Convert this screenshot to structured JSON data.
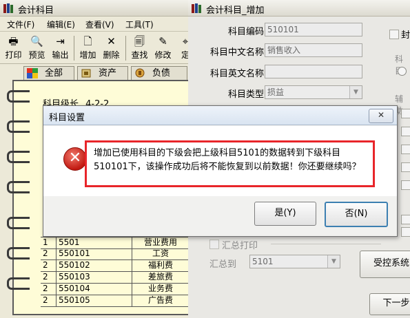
{
  "win1": {
    "title": "会计科目",
    "menu": [
      "文件(F)",
      "编辑(E)",
      "查看(V)",
      "工具(T)"
    ],
    "toolbar": [
      "打印",
      "预览",
      "输出",
      "增加",
      "删除",
      "查找",
      "修改",
      "定"
    ],
    "tabs": [
      "全部",
      "资产",
      "负债"
    ],
    "level_label": "科目级长",
    "level_value": "4-2-2",
    "rows": [
      {
        "grade": "1",
        "code": "5501",
        "name": "营业费用"
      },
      {
        "grade": "2",
        "code": "550101",
        "name": "工资"
      },
      {
        "grade": "2",
        "code": "550102",
        "name": "福利费"
      },
      {
        "grade": "2",
        "code": "550103",
        "name": "差旅费"
      },
      {
        "grade": "2",
        "code": "550104",
        "name": "业务费"
      },
      {
        "grade": "2",
        "code": "550105",
        "name": "广告费"
      }
    ]
  },
  "win2": {
    "title": "会计科目_增加",
    "code_label": "科目编码",
    "code_value": "510101",
    "cn_label": "科目中文名称",
    "cn_value": "销售收入",
    "en_label": "科目英文名称",
    "en_value": "",
    "type_label": "科目类型",
    "type_value": "损益",
    "seal_label": "封",
    "nature_label": "科目",
    "aux_label": "辅助",
    "summary_print_label": "汇总打印",
    "summary_to_label": "汇总到",
    "summary_to_value": "5101",
    "controlled_button": "受控系统",
    "next_button": "下一步"
  },
  "dialog": {
    "title": "科目设置",
    "close": "✕",
    "message": "增加已使用科目的下级会把上级科目5101的数据转到下级科目510101下，该操作成功后将不能恢复到以前数据！你还要继续吗？",
    "yes": "是(Y)",
    "no": "否(N)"
  }
}
